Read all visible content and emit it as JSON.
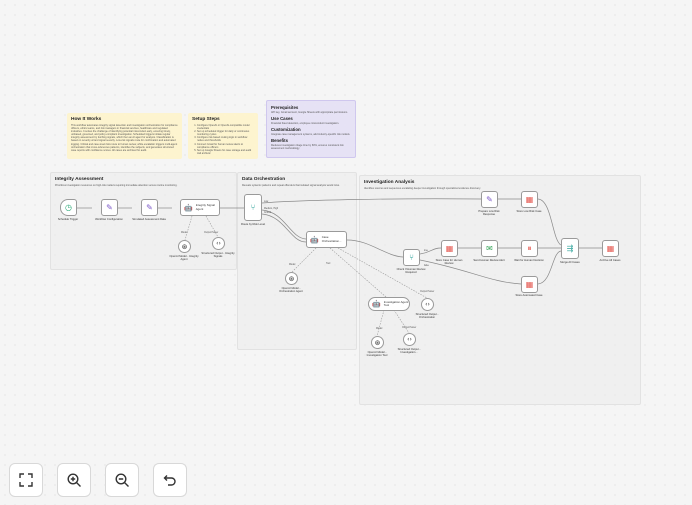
{
  "notes": {
    "how_it_works": {
      "title": "How It Works",
      "body": "This workflow automates integrity signal detection and investigation orchestration for compliance officers, ethics teams, and risk managers in financial services, healthcare and regulated industries. It solves the challenge of identifying potential misconduct early, ensuring timely, unbiased, governed, and policy-compliant investigation. Scheduled triggers initiate regular integrity assessment by fetching signals, which then an AI agent for analysis. Classification is based on severity or/and signal severity. Low-risk signals route for confirmation and automated logging. Critical and case-level risks route to human review, while escalation triggers multi-agent orchestration that cross-references patterns, identifies the subjects, and generates structured case reports with confidence scores. All cases are archived for audit."
    },
    "setup_steps": {
      "title": "Setup Steps",
      "items": [
        "Configure OpenAI or OpenAI-compatible model credentials",
        "Set up scheduled trigger for daily or continuous monitoring cycles",
        "Configure risk-based routing logic in workflow nodes and thresholds",
        "Connect Gmail for human review alerts to compliance officers",
        "Set up Google Sheets for case storage and audit trail archival"
      ]
    },
    "info": {
      "prerequisites_title": "Prerequisites",
      "prerequisites_body": "API key, Gmail account, Google Sheets with appropriate permissions.",
      "usecases_title": "Use Cases",
      "usecases_body": "Financial fraud detection, employee misconduct investigation.",
      "customization_title": "Customization",
      "customization_body": "Integrate case management systems, add industry-specific risk models.",
      "benefits_title": "Benefits",
      "benefits_body": "Reduces investigation triage time by 60%, ensures consistent risk assessment methodology."
    },
    "integrity": {
      "title": "Integrity Assessment",
      "subtitle": "Prioritizes investigation resources on high-risk matters requiring immediate attention versus routine monitoring."
    },
    "orchestration": {
      "title": "Data Orchestration",
      "subtitle": "Reveals systemic patterns and repeat offenders that isolated signal analysis would miss."
    },
    "investigation": {
      "title": "Investigation Analysis",
      "subtitle": "Identifies sources and sequences escalating deeper investigation through specialized evidence discovery."
    }
  },
  "nodes": {
    "schedule_trigger": "Schedule Trigger",
    "workflow_config": "Workflow Configuration",
    "simulated_data": "Simulated Assessment Data",
    "integrity_agent": "Integrity Signal Agent",
    "integrity_model": "OpenAI Model - Integrity Agent",
    "integrity_output": "Structured Output - Integrity Signals",
    "route_by_risk": "Route by Risk Level",
    "case_orchestration": "Case Orchestration...",
    "orchestration_model": "OpenAI Model - Orchestration Agent",
    "investigation_tool": "Investigation Agent Tool",
    "orchestration_output": "Structured Output - Orchestration",
    "investigation_model": "OpenAI Model - Investigation Tool",
    "investigation_output": "Structured Output - Investigation...",
    "prepare_low_risk": "Prepare Low Risk Response",
    "store_low_risk": "Store Low Risk Case",
    "check_review": "Check If Human Review Required",
    "store_human_review": "Store Case for Human Review",
    "send_review_alert": "Send Human Review Alert",
    "wait_decision": "Wait for Human Decision",
    "merge_cases": "Merge All Cases",
    "archive_cases": "Archive All Cases",
    "store_automated": "Store Automated Case"
  },
  "port_labels": {
    "model": "Model",
    "output_parser": "Output Parser",
    "tool": "Tool",
    "low": "Low",
    "medium_high": "Medium, High",
    "critical": "Critical",
    "true": "true",
    "false": "false"
  },
  "controls": {
    "fit_view": "fit-view-icon",
    "zoom_in": "zoom-in-icon",
    "zoom_out": "zoom-out-icon",
    "undo": "undo-icon"
  },
  "colors": {
    "sticky_yellow": "#fdf4cf",
    "sticky_purple": "#e6e2f5",
    "trigger_green": "#2aa876",
    "tool_purple": "#7b57c8",
    "sheets_red": "#e4574f",
    "gmail_green": "#3aa65b",
    "branch_teal": "#2fa39a",
    "edge_gray": "#8a8a8a"
  }
}
